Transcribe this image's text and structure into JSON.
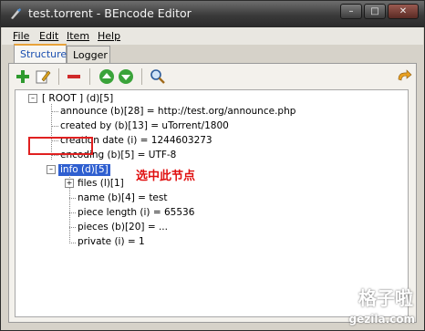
{
  "window": {
    "title": "test.torrent - BEncode Editor"
  },
  "menu": [
    {
      "label": "File"
    },
    {
      "label": "Edit"
    },
    {
      "label": "Item"
    },
    {
      "label": "Help"
    }
  ],
  "tabs": [
    {
      "label": "Structure",
      "active": true
    },
    {
      "label": "Logger",
      "active": false
    }
  ],
  "toolbar": {
    "buttons": [
      "add-icon",
      "edit-icon",
      "remove-icon",
      "move-up-icon",
      "move-down-icon",
      "search-icon"
    ],
    "right_button": "refresh-icon"
  },
  "tree": {
    "root": "[ ROOT ] (d)[5]",
    "children": [
      "announce (b)[28] = http://test.org/announce.php",
      "created by (b)[13] = uTorrent/1800",
      "creation date (i) = 1244603273",
      "encoding (b)[5] = UTF-8"
    ],
    "info": {
      "label": "info (d)[5]",
      "children": [
        "files (l)[1]",
        "name (b)[4] = test",
        "piece length (i) = 65536",
        "pieces (b)[20] = ...",
        "private (i) = 1"
      ]
    }
  },
  "annotation": "选中此节点",
  "watermark": {
    "text": "格子啦",
    "url": "gezila.com"
  },
  "colors": {
    "selection": "#2f5fd0",
    "callout": "#e02020"
  }
}
